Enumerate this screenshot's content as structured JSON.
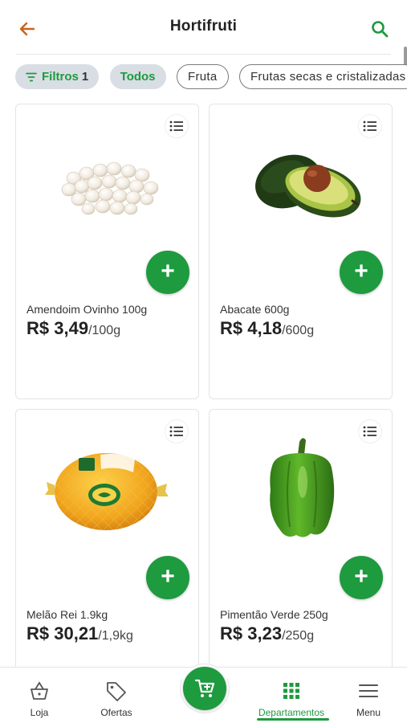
{
  "header": {
    "title": "Hortifruti",
    "back_icon": "arrow-left-icon",
    "search_icon": "search-icon"
  },
  "filters": {
    "filter_label": "Filtros",
    "filter_count": "1",
    "chips": [
      "Todos",
      "Fruta",
      "Frutas secas e cristalizadas"
    ]
  },
  "products": [
    {
      "name": "Amendoim Ovinho 100g",
      "price": "R$ 3,49",
      "unit": "/100g",
      "image": "peanuts"
    },
    {
      "name": "Abacate 600g",
      "price": "R$ 4,18",
      "unit": "/600g",
      "image": "avocado"
    },
    {
      "name": "Melão Rei 1.9kg",
      "price": "R$ 30,21",
      "unit": "/1,9kg",
      "image": "melon"
    },
    {
      "name": "Pimentão Verde 250g",
      "price": "R$ 3,23",
      "unit": "/250g",
      "image": "green-pepper"
    }
  ],
  "nav": {
    "items": [
      {
        "label": "Loja",
        "icon": "basket-icon"
      },
      {
        "label": "Ofertas",
        "icon": "tag-icon"
      },
      {
        "label": "Departamentos",
        "icon": "grid-icon"
      },
      {
        "label": "Menu",
        "icon": "hamburger-menu-icon"
      }
    ],
    "cart_icon": "cart-icon",
    "active": "Departamentos"
  },
  "colors": {
    "accent": "#1e9a3f",
    "back_arrow": "#c8641e",
    "chip_fill": "#d8dee3"
  }
}
